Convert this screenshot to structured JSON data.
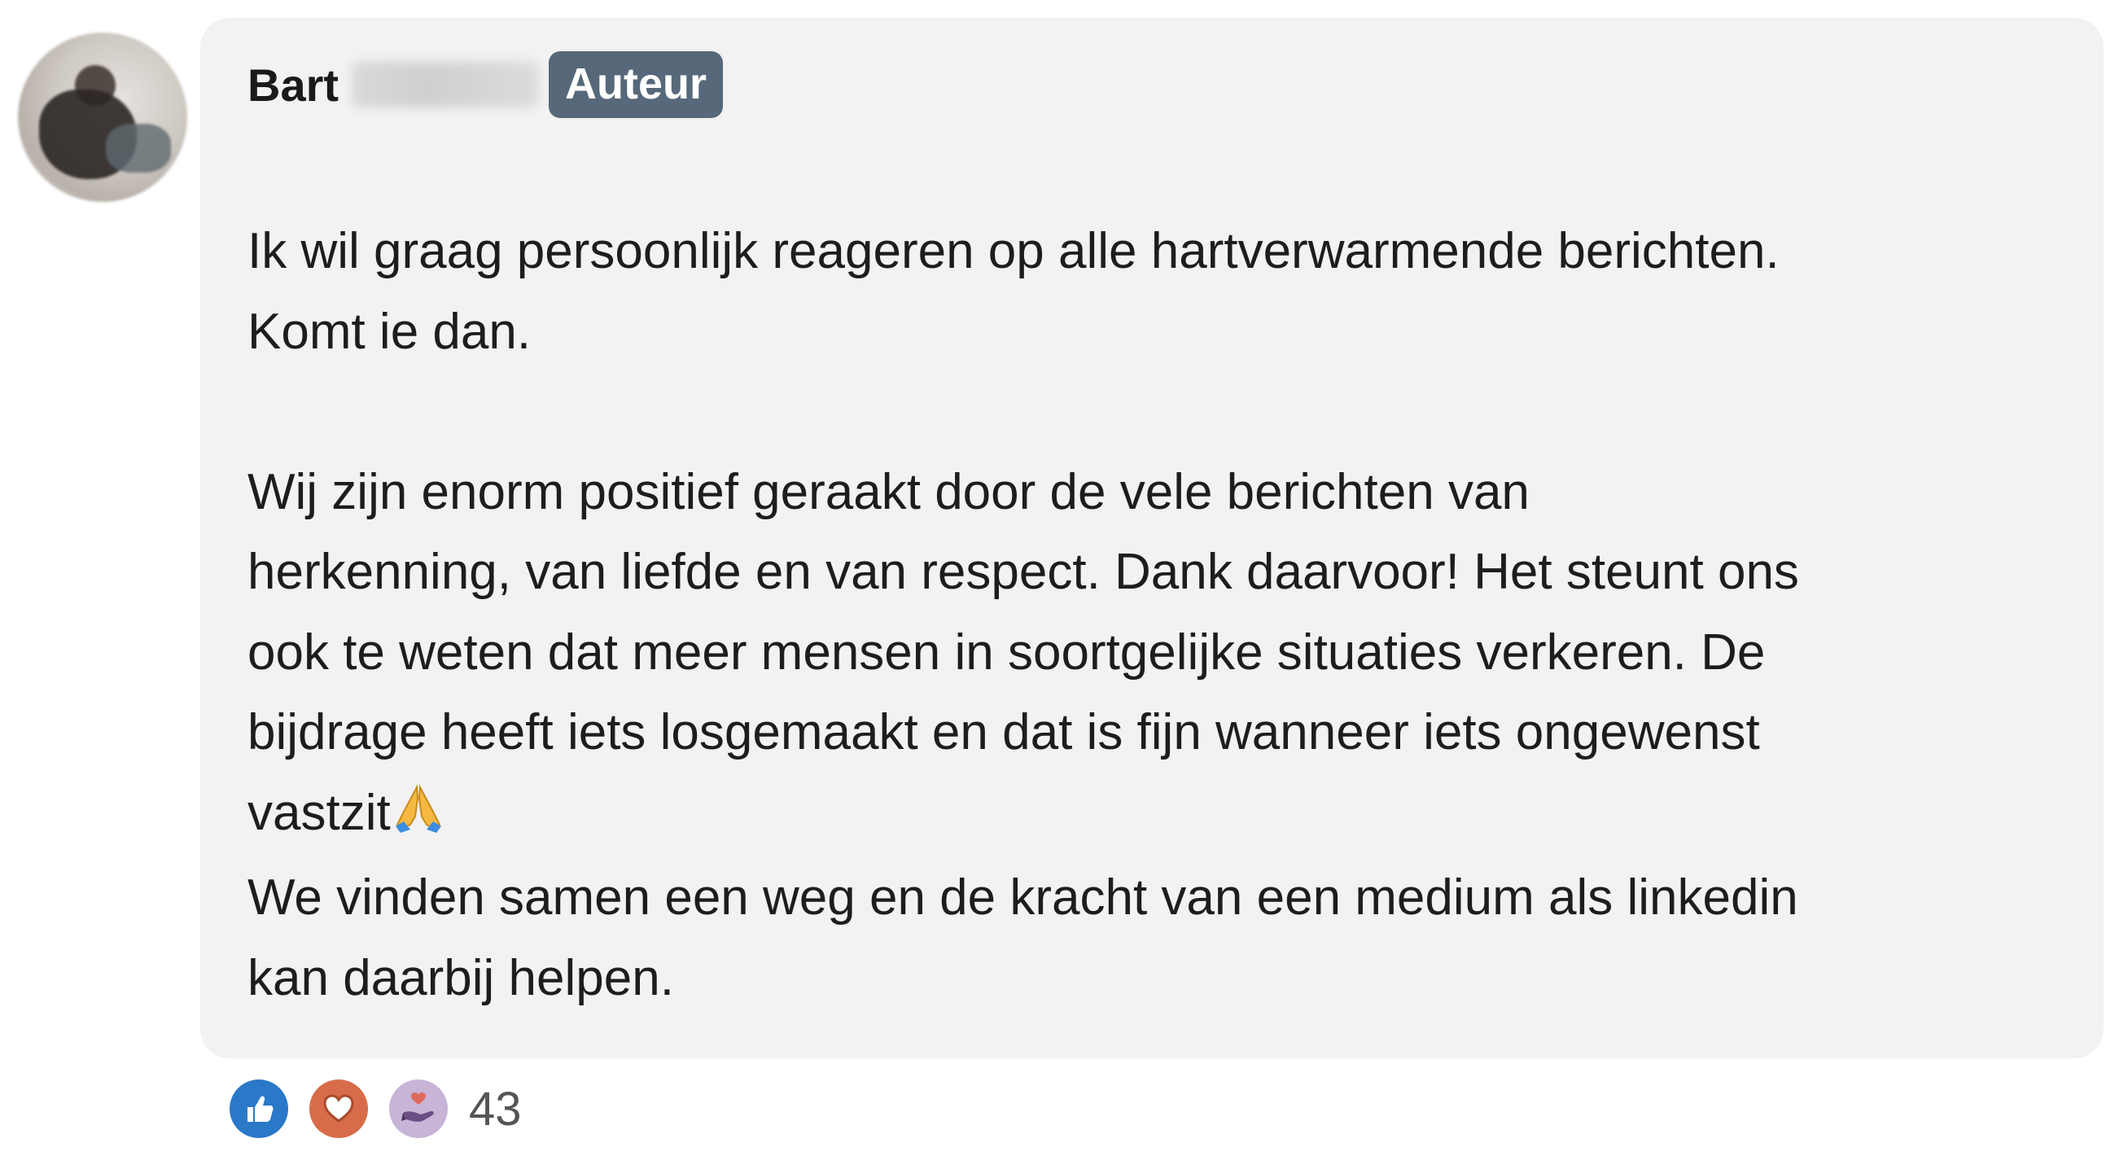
{
  "comment": {
    "author_first": "Bart",
    "author_badge": "Auteur",
    "paragraphs": [
      "Ik wil graag persoonlijk reageren op alle hartverwarmende berichten.",
      "Komt ie dan.",
      "",
      "Wij zijn enorm positief geraakt door de vele berichten van",
      "herkenning, van liefde en van respect. Dank daarvoor! Het steunt ons",
      "ook te weten dat meer mensen in soortgelijke situaties verkeren. De",
      "bijdrage heeft iets losgemaakt en dat is fijn wanneer iets ongewenst",
      "vastzit",
      "We vinden samen een weg en de kracht van een medium als linkedin",
      "kan daarbij helpen."
    ],
    "reactions": {
      "icons": [
        "like-icon",
        "love-icon",
        "support-icon"
      ],
      "count": "43"
    }
  },
  "colors": {
    "bubble": "#f2f2f2",
    "badge": "#56687a",
    "like": "#2a78c8",
    "love": "#d86c4a",
    "support": "#c7b4d6"
  }
}
